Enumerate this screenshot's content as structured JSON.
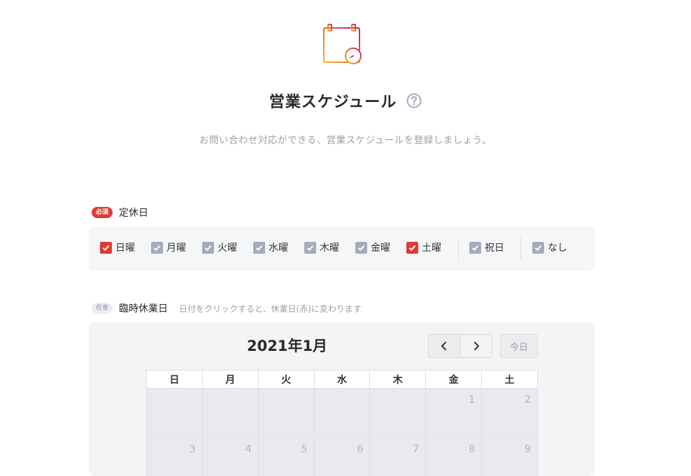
{
  "header": {
    "icon": "calendar-clock-icon",
    "title": "営業スケジュール",
    "help_icon": "question-circle-icon",
    "subtitle": "お問い合わせ対応ができる、営業スケジュールを登録しましょう。"
  },
  "regular_holidays": {
    "badge": "必須",
    "label": "定休日",
    "options": [
      {
        "label": "日曜",
        "checked": true,
        "color": "#e03a33"
      },
      {
        "label": "月曜",
        "checked": true,
        "color": "#a4abbd"
      },
      {
        "label": "火曜",
        "checked": true,
        "color": "#a4abbd"
      },
      {
        "label": "水曜",
        "checked": true,
        "color": "#a4abbd"
      },
      {
        "label": "木曜",
        "checked": true,
        "color": "#a4abbd"
      },
      {
        "label": "金曜",
        "checked": true,
        "color": "#a4abbd"
      },
      {
        "label": "土曜",
        "checked": true,
        "color": "#e03a33"
      },
      {
        "label": "祝日",
        "checked": true,
        "color": "#a4abbd"
      },
      {
        "label": "なし",
        "checked": true,
        "color": "#a4abbd"
      }
    ]
  },
  "temporary_holidays": {
    "badge": "任意",
    "label": "臨時休業日",
    "hint": "日付をクリックすると、休業日(赤)に変わります"
  },
  "calendar": {
    "month_title": "2021年1月",
    "prev_icon": "chevron-left-icon",
    "next_icon": "chevron-right-icon",
    "today_label": "今日",
    "weekdays": [
      "日",
      "月",
      "火",
      "水",
      "木",
      "金",
      "土"
    ],
    "weeks": [
      [
        "",
        "",
        "",
        "",
        "",
        "1",
        "2"
      ],
      [
        "3",
        "4",
        "5",
        "6",
        "7",
        "8",
        "9"
      ]
    ]
  },
  "colors": {
    "accent_red": "#e03a33",
    "checkbox_gray": "#a4abbd",
    "icon_gradient_start": "#f2b81f",
    "icon_gradient_end": "#c0207a"
  }
}
